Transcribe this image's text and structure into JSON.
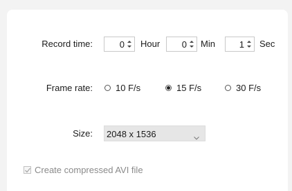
{
  "record_time": {
    "label": "Record time:",
    "hour_value": "0",
    "hour_unit": "Hour",
    "min_value": "0",
    "min_unit": "Min",
    "sec_value": "1",
    "sec_unit": "Sec"
  },
  "frame_rate": {
    "label": "Frame rate:",
    "options": [
      {
        "label": "10 F/s",
        "checked": false
      },
      {
        "label": "15 F/s",
        "checked": true
      },
      {
        "label": "30 F/s",
        "checked": false
      }
    ]
  },
  "size": {
    "label": "Size:",
    "selected": "2048 x 1536",
    "icon": "chevron-down-icon"
  },
  "compressed": {
    "label": "Create compressed AVI file",
    "checked": true,
    "disabled": true
  },
  "colors": {
    "background": "#f3f3f3",
    "panel": "#ffffff",
    "select_bg": "#e6e6e6",
    "disabled_text": "#8a8a8a"
  }
}
